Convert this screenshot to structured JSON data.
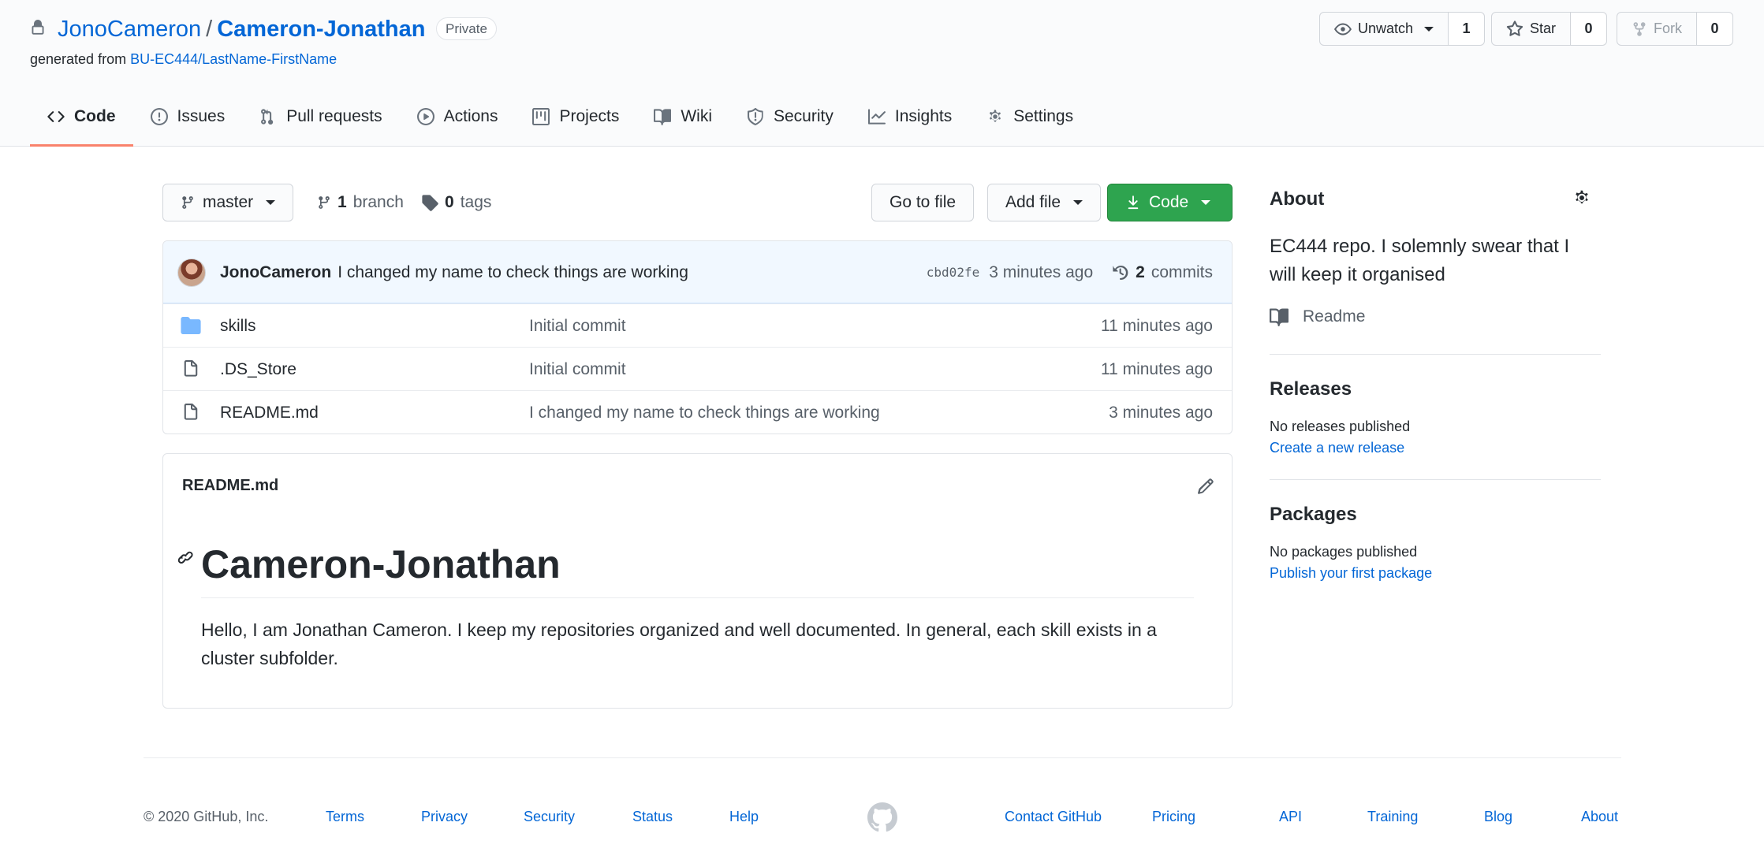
{
  "repo": {
    "owner": "JonoCameron",
    "separator": "/",
    "name": "Cameron-Jonathan",
    "visibility": "Private",
    "generated_prefix": "generated from",
    "template": "BU-EC444/LastName-FirstName"
  },
  "social": {
    "watch_label": "Unwatch",
    "watch_count": "1",
    "star_label": "Star",
    "star_count": "0",
    "fork_label": "Fork",
    "fork_count": "0"
  },
  "tabs": [
    {
      "label": "Code",
      "icon": "code-icon",
      "selected": true
    },
    {
      "label": "Issues",
      "icon": "issue-icon"
    },
    {
      "label": "Pull requests",
      "icon": "pull-request-icon"
    },
    {
      "label": "Actions",
      "icon": "play-icon"
    },
    {
      "label": "Projects",
      "icon": "project-icon"
    },
    {
      "label": "Wiki",
      "icon": "book-icon"
    },
    {
      "label": "Security",
      "icon": "shield-icon"
    },
    {
      "label": "Insights",
      "icon": "graph-icon"
    },
    {
      "label": "Settings",
      "icon": "gear-icon"
    }
  ],
  "toolbar": {
    "branch_name": "master",
    "branch_count": "1",
    "branch_label": "branch",
    "tag_count": "0",
    "tag_label": "tags",
    "goto_file": "Go to file",
    "add_file": "Add file",
    "code": "Code"
  },
  "latest_commit": {
    "author": "JonoCameron",
    "message": "I changed my name to check things are working",
    "sha": "cbd02fe",
    "age": "3 minutes ago",
    "commit_count": "2",
    "commit_label": "commits"
  },
  "files": [
    {
      "name": "skills",
      "type": "folder",
      "message": "Initial commit",
      "age": "11 minutes ago"
    },
    {
      "name": ".DS_Store",
      "type": "file",
      "message": "Initial commit",
      "age": "11 minutes ago"
    },
    {
      "name": "README.md",
      "type": "file",
      "message": "I changed my name to check things are working",
      "age": "3 minutes ago"
    }
  ],
  "readme": {
    "filename": "README.md",
    "heading": "Cameron-Jonathan",
    "body": "Hello, I am Jonathan Cameron. I keep my repositories organized and well documented. In general, each skill exists in a cluster subfolder."
  },
  "sidebar": {
    "about_title": "About",
    "description": "EC444 repo. I solemnly swear that I will keep it organised",
    "readme_label": "Readme",
    "releases_title": "Releases",
    "releases_none": "No releases published",
    "releases_link": "Create a new release",
    "packages_title": "Packages",
    "packages_none": "No packages published",
    "packages_link": "Publish your first package"
  },
  "footer": {
    "copyright": "© 2020 GitHub, Inc.",
    "left_links": [
      "Terms",
      "Privacy",
      "Security",
      "Status",
      "Help"
    ],
    "right_links": [
      "Contact GitHub",
      "Pricing",
      "API",
      "Training",
      "Blog",
      "About"
    ]
  },
  "colors": {
    "link": "#0366d6",
    "primary_button": "#2ea44f",
    "selected_tab_underline": "#f9826c",
    "commit_bar": "#f1f8ff",
    "folder_icon": "#79b8ff"
  }
}
